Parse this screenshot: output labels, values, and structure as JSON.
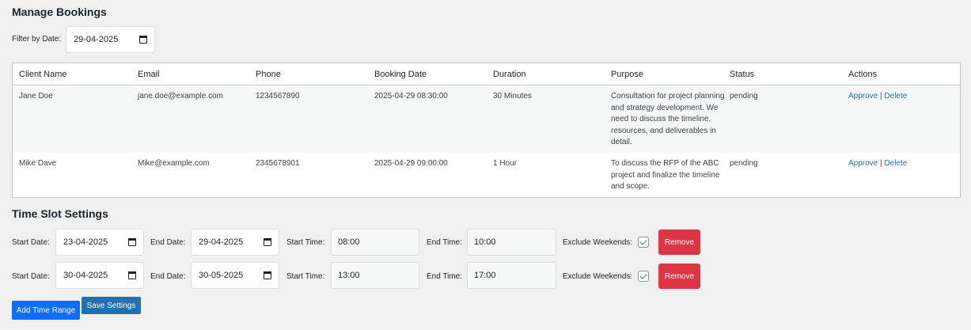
{
  "bookings": {
    "title": "Manage Bookings",
    "filter_label": "Filter by Date:",
    "filter_value": "29-04-2025",
    "columns": [
      "Client Name",
      "Email",
      "Phone",
      "Booking Date",
      "Duration",
      "Purpose",
      "Status",
      "Actions"
    ],
    "rows": [
      {
        "client": "Jane Doe",
        "email": "jane.doe@example.com",
        "phone": "1234567890",
        "date": "2025-04-29 08:30:00",
        "duration": "30 Minutes",
        "purpose": "Consultation for project planning and strategy development. We need to discuss the timeline, resources, and deliverables in detail.",
        "status": "pending",
        "approve": "Approve",
        "sep": "|",
        "delete": "Delete"
      },
      {
        "client": "Mike Dave",
        "email": "Mike@example.com",
        "phone": "2345678901",
        "date": "2025-04-29 09:00:00",
        "duration": "1 Hour",
        "purpose": "To discuss the RFP of the ABC project and finalize the timeline and scope.",
        "status": "pending",
        "approve": "Approve",
        "sep": "|",
        "delete": "Delete"
      }
    ]
  },
  "timeslots": {
    "title": "Time Slot Settings",
    "labels": {
      "start_date": "Start Date:",
      "end_date": "End Date:",
      "start_time": "Start Time:",
      "end_time": "End Time:",
      "exclude_weekends": "Exclude Weekends:"
    },
    "ranges": [
      {
        "start_date": "23-04-2025",
        "end_date": "29-04-2025",
        "start_time": "08:00",
        "end_time": "10:00",
        "exclude_weekends": true,
        "remove": "Remove"
      },
      {
        "start_date": "30-04-2025",
        "end_date": "30-05-2025",
        "start_time": "13:00",
        "end_time": "17:00",
        "exclude_weekends": true,
        "remove": "Remove"
      }
    ],
    "add_button": "Add Time Range",
    "save_button": "Save Settings"
  },
  "colors": {
    "link": "#2271b1",
    "remove": "#dc3545",
    "add_button": "#0d6efd",
    "save_button": "#2271b1"
  },
  "icons": [
    "calendar-icon",
    "checkbox-check-icon"
  ]
}
